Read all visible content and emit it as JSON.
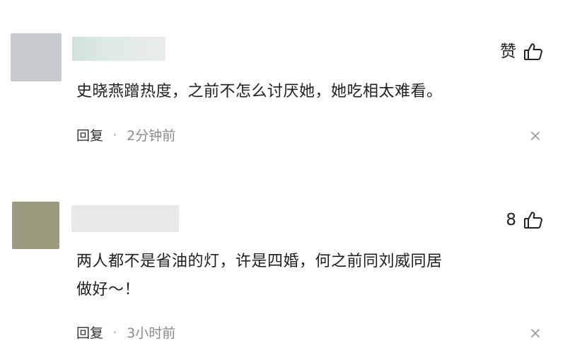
{
  "comments": [
    {
      "like_label": "赞",
      "text": "史晓燕蹭热度，之前不怎么讨厌她，她吃相太难看。",
      "reply_label": "回复",
      "separator": "·",
      "time": "2分钟前",
      "avatar_color": "#c6cbcf"
    },
    {
      "like_label": "8",
      "text": "两人都不是省油的灯，许是四婚，何之前同刘威同居\n做好～！",
      "reply_label": "回复",
      "separator": "·",
      "time": "3小时前",
      "avatar_color": "#9a9b7f"
    }
  ],
  "icons": {
    "like": "thumbs-up-icon",
    "dismiss": "close-icon"
  }
}
